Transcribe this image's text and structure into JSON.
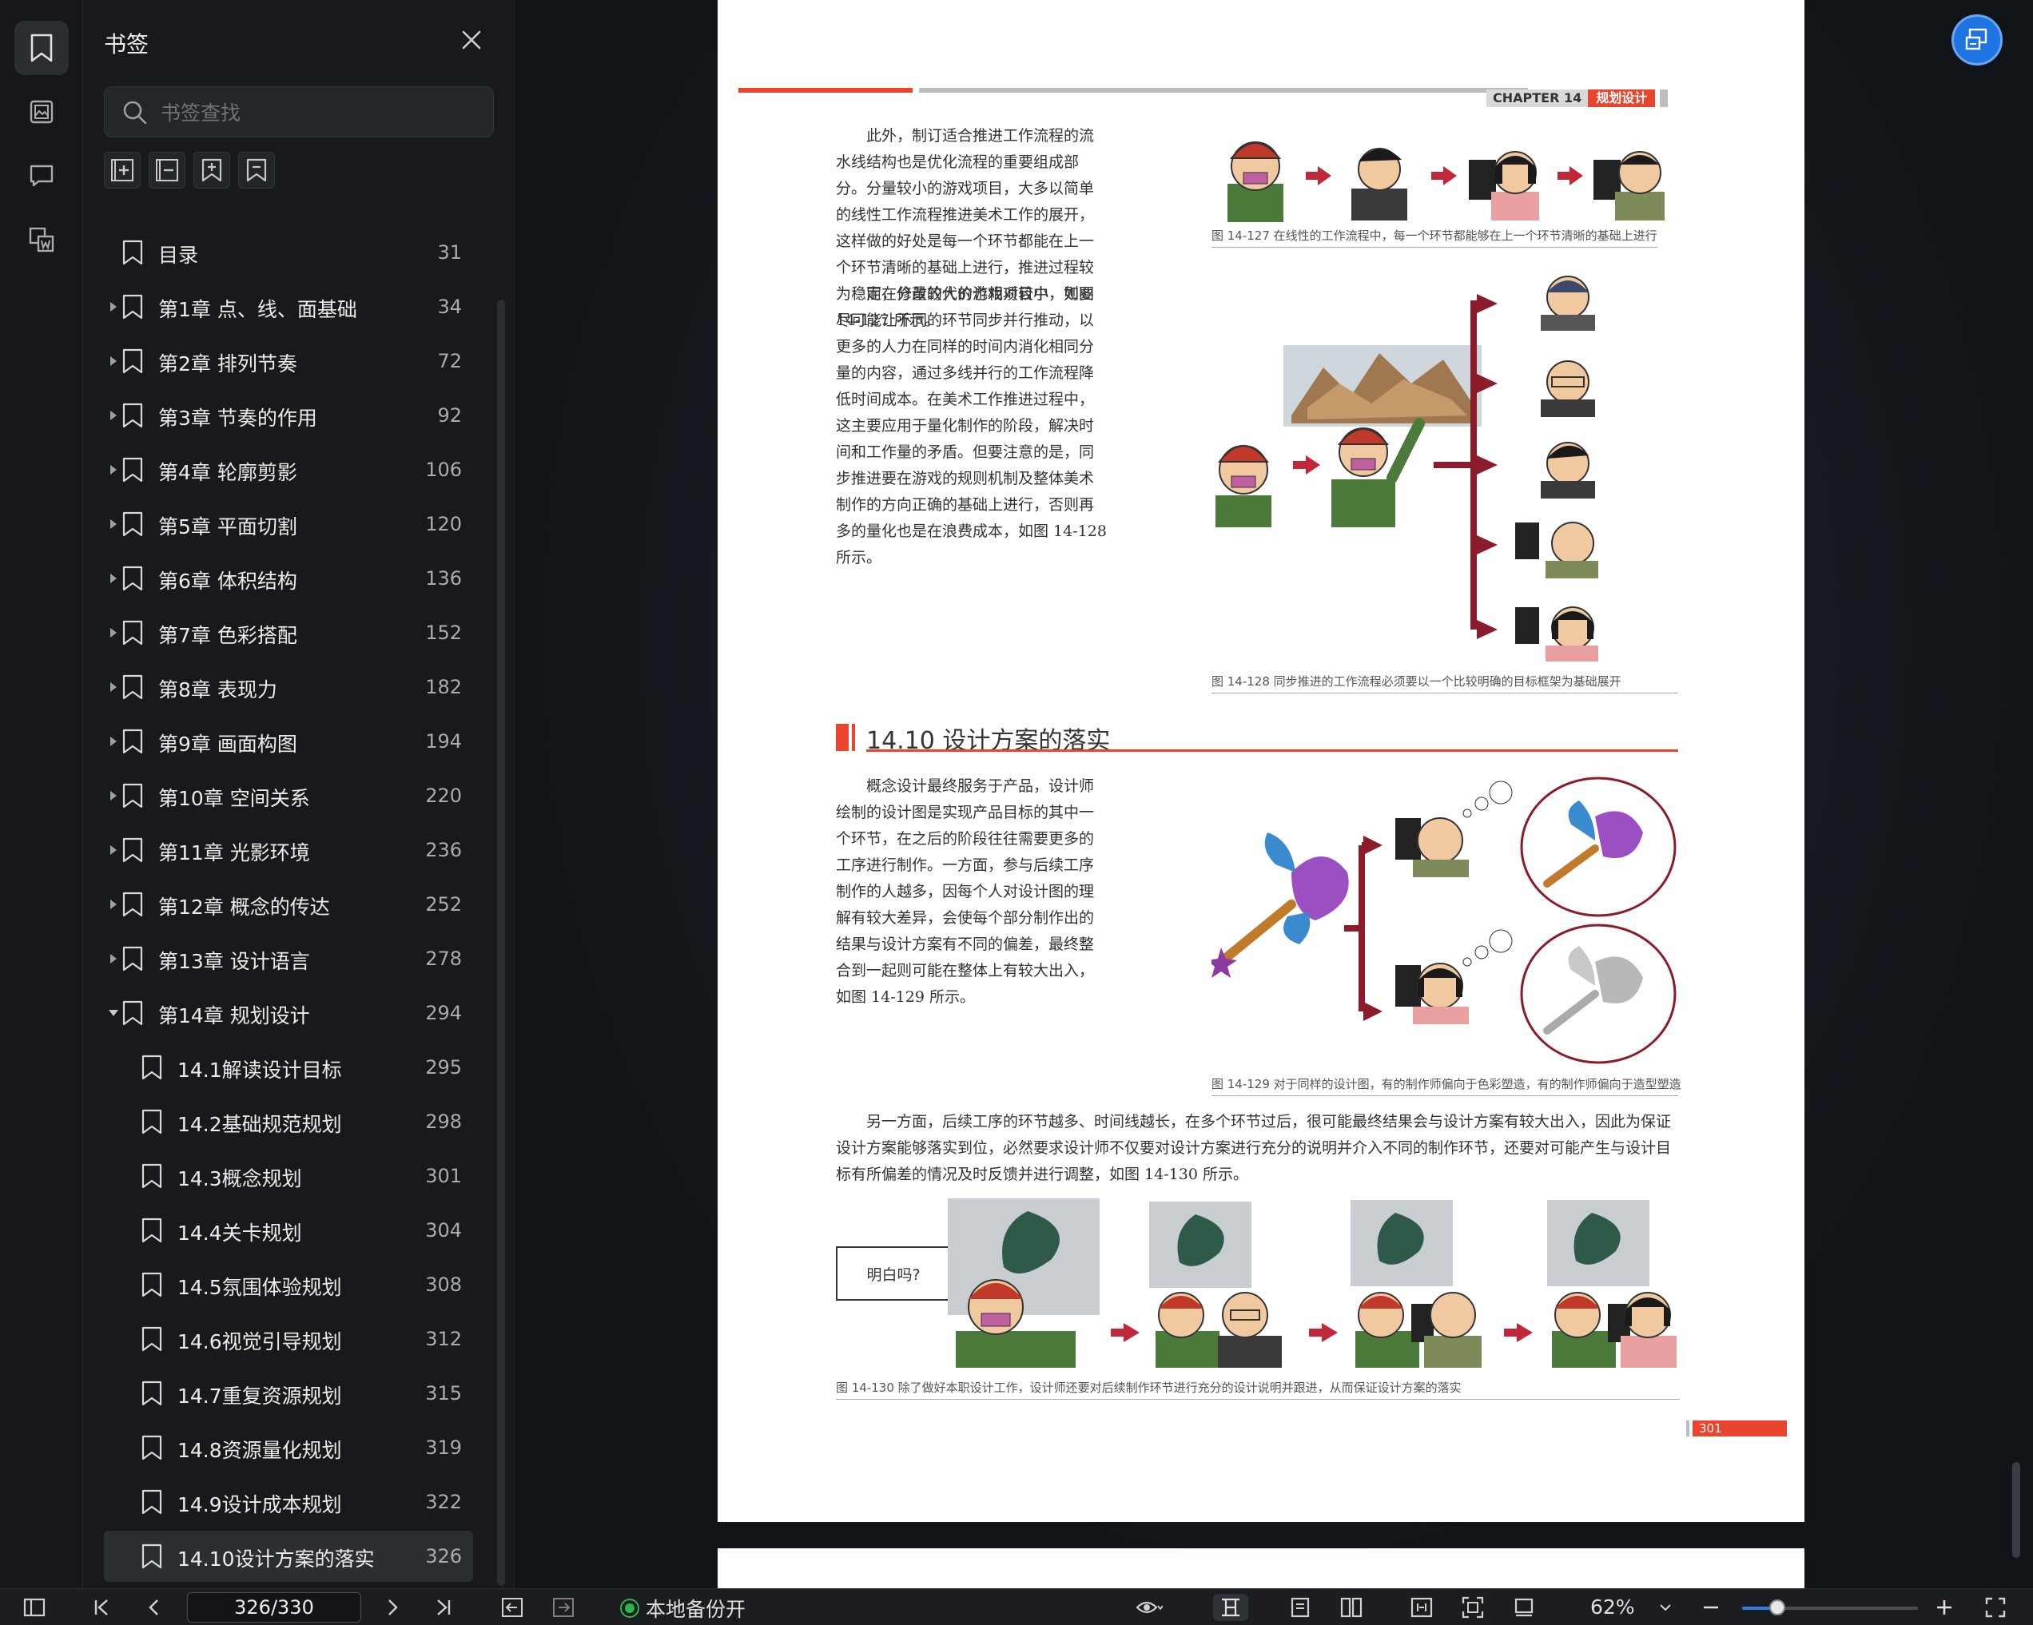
{
  "sidebar": {
    "rail_icons": [
      "bookmark-icon",
      "thumbnail-icon",
      "comment-icon",
      "extract-icon"
    ],
    "panel_title": "书签",
    "search_placeholder": "书签查找",
    "tools": [
      "add-bookmark-icon",
      "remove-bookmark-icon",
      "expand-bookmark-icon",
      "bookmark-outline-icon"
    ],
    "bookmarks": [
      {
        "label": "目录",
        "page": "31",
        "level": 0,
        "expandable": false,
        "open": false,
        "selected": false
      },
      {
        "label": "第1章 点、线、面基础",
        "page": "34",
        "level": 0,
        "expandable": true,
        "open": false,
        "selected": false
      },
      {
        "label": "第2章 排列节奏",
        "page": "72",
        "level": 0,
        "expandable": true,
        "open": false,
        "selected": false
      },
      {
        "label": "第3章 节奏的作用",
        "page": "92",
        "level": 0,
        "expandable": true,
        "open": false,
        "selected": false
      },
      {
        "label": "第4章 轮廓剪影",
        "page": "106",
        "level": 0,
        "expandable": true,
        "open": false,
        "selected": false
      },
      {
        "label": "第5章 平面切割",
        "page": "120",
        "level": 0,
        "expandable": true,
        "open": false,
        "selected": false
      },
      {
        "label": "第6章 体积结构",
        "page": "136",
        "level": 0,
        "expandable": true,
        "open": false,
        "selected": false
      },
      {
        "label": "第7章 色彩搭配",
        "page": "152",
        "level": 0,
        "expandable": true,
        "open": false,
        "selected": false
      },
      {
        "label": "第8章 表现力",
        "page": "182",
        "level": 0,
        "expandable": true,
        "open": false,
        "selected": false
      },
      {
        "label": "第9章 画面构图",
        "page": "194",
        "level": 0,
        "expandable": true,
        "open": false,
        "selected": false
      },
      {
        "label": "第10章 空间关系",
        "page": "220",
        "level": 0,
        "expandable": true,
        "open": false,
        "selected": false
      },
      {
        "label": "第11章 光影环境",
        "page": "236",
        "level": 0,
        "expandable": true,
        "open": false,
        "selected": false
      },
      {
        "label": "第12章 概念的传达",
        "page": "252",
        "level": 0,
        "expandable": true,
        "open": false,
        "selected": false
      },
      {
        "label": "第13章 设计语言",
        "page": "278",
        "level": 0,
        "expandable": true,
        "open": false,
        "selected": false
      },
      {
        "label": "第14章 规划设计",
        "page": "294",
        "level": 0,
        "expandable": true,
        "open": true,
        "selected": false
      },
      {
        "label": "14.1解读设计目标",
        "page": "295",
        "level": 1,
        "expandable": false,
        "open": false,
        "selected": false
      },
      {
        "label": "14.2基础规范规划",
        "page": "298",
        "level": 1,
        "expandable": false,
        "open": false,
        "selected": false
      },
      {
        "label": "14.3概念规划",
        "page": "301",
        "level": 1,
        "expandable": false,
        "open": false,
        "selected": false
      },
      {
        "label": "14.4关卡规划",
        "page": "304",
        "level": 1,
        "expandable": false,
        "open": false,
        "selected": false
      },
      {
        "label": "14.5氛围体验规划",
        "page": "308",
        "level": 1,
        "expandable": false,
        "open": false,
        "selected": false
      },
      {
        "label": "14.6视觉引导规划",
        "page": "312",
        "level": 1,
        "expandable": false,
        "open": false,
        "selected": false
      },
      {
        "label": "14.7重复资源规划",
        "page": "315",
        "level": 1,
        "expandable": false,
        "open": false,
        "selected": false
      },
      {
        "label": "14.8资源量化规划",
        "page": "319",
        "level": 1,
        "expandable": false,
        "open": false,
        "selected": false
      },
      {
        "label": "14.9设计成本规划",
        "page": "322",
        "level": 1,
        "expandable": false,
        "open": false,
        "selected": false
      },
      {
        "label": "14.10设计方案的落实",
        "page": "326",
        "level": 1,
        "expandable": false,
        "open": false,
        "selected": true
      }
    ]
  },
  "document": {
    "header_chapter": "CHAPTER 14",
    "header_title": "规划设计",
    "para1": "此外，制订适合推进工作流程的流水线结构也是优化流程的重要组成部分。分量较小的游戏项目，大多以简单的线性工作流程推进美术工作的展开，这样做的好处是每一个环节都能在上一个环节清晰的基础上进行，推进过程较为稳定，修改的代价也相对较小，如图 14-127 所示。",
    "para2": "而在分量较大的游戏项目中，则要尽可能让不同的环节同步并行推动，以更多的人力在同样的时间内消化相同分量的内容，通过多线并行的工作流程降低时间成本。在美术工作推进过程中，这主要应用于量化制作的阶段，解决时间和工作量的矛盾。但要注意的是，同步推进要在游戏的规则机制及整体美术制作的方向正确的基础上进行，否则再多的量化也是在浪费成本，如图 14-128 所示。",
    "cap127": "图 14-127  在线性的工作流程中，每一个环节都能够在上一个环节清晰的基础上进行",
    "cap128": "图 14-128  同步推进的工作流程必须要以一个比较明确的目标框架为基础展开",
    "section_title": "14.10 设计方案的落实",
    "para3": "概念设计最终服务于产品，设计师绘制的设计图是实现产品目标的其中一个环节，在之后的阶段往往需要更多的工序进行制作。一方面，参与后续工序制作的人越多，因每个人对设计图的理解有较大差异，会使每个部分制作出的结果与设计方案有不同的偏差，最终整合到一起则可能在整体上有较大出入，如图 14-129 所示。",
    "cap129": "图 14-129  对于同样的设计图，有的制作师偏向于色彩塑造，有的制作师偏向于造型塑造",
    "para4": "另一方面，后续工序的环节越多、时间线越长，在多个环节过后，很可能最终结果会与设计方案有较大出入，因此为保证设计方案能够落实到位，必然要求设计师不仅要对设计方案进行充分的说明并介入不同的制作环节，还要对可能产生与设计目标有所偏差的情况及时反馈并进行调整，如图 14-130 所示。",
    "bubble": "明白吗?",
    "cap130": "图 14-130  除了做好本职设计工作，设计师还要对后续制作环节进行充分的设计说明并跟进，从而保证设计方案的落实",
    "page_number": "301"
  },
  "toolbar": {
    "page_indicator": "326/330",
    "backup_label": "本地备份开",
    "zoom_label": "62%",
    "zoom_fraction": 0.2
  },
  "colors": {
    "accent_red": "#e8442e",
    "dark_red": "#8a1c2b",
    "selected_row": "#2b2e33",
    "brand_blue": "#1e74e0"
  }
}
